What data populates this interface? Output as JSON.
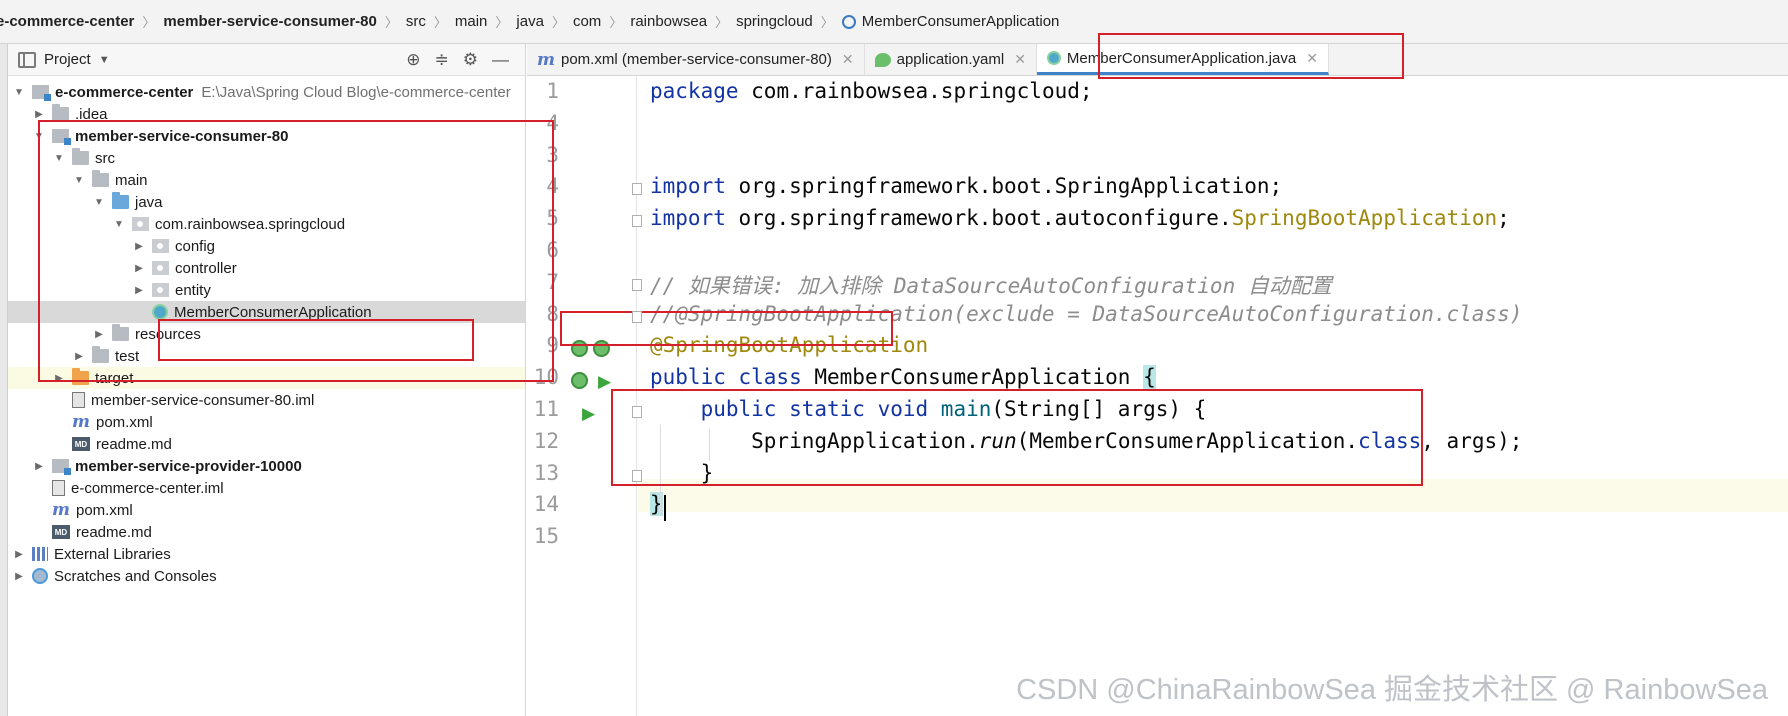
{
  "breadcrumb": [
    {
      "label": "e-commerce-center",
      "bold": true
    },
    {
      "label": "member-service-consumer-80",
      "bold": true
    },
    {
      "label": "src",
      "bold": false
    },
    {
      "label": "main",
      "bold": false
    },
    {
      "label": "java",
      "bold": false
    },
    {
      "label": "com",
      "bold": false
    },
    {
      "label": "rainbowsea",
      "bold": false
    },
    {
      "label": "springcloud",
      "bold": false
    },
    {
      "label": "MemberConsumerApplication",
      "bold": false,
      "icon": "class-icon"
    }
  ],
  "project_panel": {
    "title": "Project",
    "tree": [
      {
        "label": "e-commerce-center",
        "path": "E:\\Java\\Spring Cloud Blog\\e-commerce-center",
        "bold": true,
        "level": 0,
        "expanded": true,
        "icon": "module"
      },
      {
        "label": ".idea",
        "level": 1,
        "expanded": false,
        "icon": "folder"
      },
      {
        "label": "member-service-consumer-80",
        "bold": true,
        "level": 1,
        "expanded": true,
        "icon": "module"
      },
      {
        "label": "src",
        "level": 2,
        "expanded": true,
        "icon": "folder"
      },
      {
        "label": "main",
        "level": 3,
        "expanded": true,
        "icon": "folder"
      },
      {
        "label": "java",
        "level": 4,
        "expanded": true,
        "icon": "folder-blue"
      },
      {
        "label": "com.rainbowsea.springcloud",
        "level": 5,
        "expanded": true,
        "icon": "package"
      },
      {
        "label": "config",
        "level": 6,
        "expanded": false,
        "icon": "package"
      },
      {
        "label": "controller",
        "level": 6,
        "expanded": false,
        "icon": "package"
      },
      {
        "label": "entity",
        "level": 6,
        "expanded": false,
        "icon": "package"
      },
      {
        "label": "MemberConsumerApplication",
        "level": 6,
        "icon": "classfile",
        "selected": true
      },
      {
        "label": "resources",
        "level": 4,
        "expanded": false,
        "icon": "folder"
      },
      {
        "label": "test",
        "level": 3,
        "expanded": false,
        "icon": "folder"
      },
      {
        "label": "target",
        "level": 2,
        "expanded": false,
        "icon": "folder-orange",
        "highlight": true
      },
      {
        "label": "member-service-consumer-80.iml",
        "level": 2,
        "icon": "iml"
      },
      {
        "label": "pom.xml",
        "level": 2,
        "icon": "maven"
      },
      {
        "label": "readme.md",
        "level": 2,
        "icon": "md"
      },
      {
        "label": "member-service-provider-10000",
        "bold": true,
        "level": 1,
        "expanded": false,
        "icon": "module"
      },
      {
        "label": "e-commerce-center.iml",
        "level": 1,
        "icon": "iml"
      },
      {
        "label": "pom.xml",
        "level": 1,
        "icon": "maven"
      },
      {
        "label": "readme.md",
        "level": 1,
        "icon": "md"
      },
      {
        "label": "External Libraries",
        "level": 0,
        "expanded": false,
        "icon": "libs"
      },
      {
        "label": "Scratches and Consoles",
        "level": 0,
        "expanded": false,
        "icon": "scratch"
      }
    ]
  },
  "tabs": [
    {
      "label": "pom.xml (member-service-consumer-80)",
      "icon": "m",
      "active": false
    },
    {
      "label": "application.yaml",
      "icon": "leaf",
      "active": false
    },
    {
      "label": "MemberConsumerApplication.java",
      "icon": "cls",
      "active": true
    }
  ],
  "editor": {
    "line_numbers": [
      "1",
      "4",
      "3",
      "4",
      "5",
      "6",
      "7",
      "8",
      "9",
      "10",
      "11",
      "12",
      "13",
      "14",
      "15"
    ],
    "lines": [
      [
        {
          "t": "package ",
          "c": "kw"
        },
        {
          "t": "com.rainbowsea.springcloud;",
          "c": ""
        }
      ],
      [],
      [],
      [
        {
          "t": "import ",
          "c": "kw"
        },
        {
          "t": "org.springframework.boot.SpringApplication;",
          "c": ""
        }
      ],
      [
        {
          "t": "import ",
          "c": "kw"
        },
        {
          "t": "org.springframework.boot.autoconfigure.",
          "c": ""
        },
        {
          "t": "SpringBootApplication",
          "c": "ann"
        },
        {
          "t": ";",
          "c": ""
        }
      ],
      [],
      [
        {
          "t": "// 如果错误: 加入排除 DataSourceAutoConfiguration 自动配置",
          "c": "cmt"
        }
      ],
      [
        {
          "t": "//@SpringBootApplication(exclude = DataSourceAutoConfiguration.class)",
          "c": "cmt"
        }
      ],
      [
        {
          "t": "@SpringBootApplication",
          "c": "ann"
        }
      ],
      [
        {
          "t": "public class ",
          "c": "kw"
        },
        {
          "t": "MemberConsumerApplication ",
          "c": ""
        },
        {
          "t": "{",
          "c": "brace"
        }
      ],
      [
        {
          "t": "    ",
          "c": ""
        },
        {
          "t": "public static void ",
          "c": "kw"
        },
        {
          "t": "main",
          "c": "mth"
        },
        {
          "t": "(String[] args) {",
          "c": ""
        }
      ],
      [
        {
          "t": "        SpringApplication.",
          "c": ""
        },
        {
          "t": "run",
          "c": "it"
        },
        {
          "t": "(MemberConsumerApplication.",
          "c": ""
        },
        {
          "t": "class",
          "c": "kw"
        },
        {
          "t": ", args);",
          "c": ""
        }
      ],
      [
        {
          "t": "    }",
          "c": ""
        }
      ],
      [
        {
          "t": "}",
          "c": "brace"
        }
      ],
      []
    ]
  },
  "watermark": "CSDN @ChinaRainbowSea 掘金技术社区 @ RainbowSea",
  "colors": {
    "accent": "#4083c9",
    "annotation_box": "#d4202a",
    "keyword": "#1233a3",
    "annotation": "#9e880d"
  }
}
